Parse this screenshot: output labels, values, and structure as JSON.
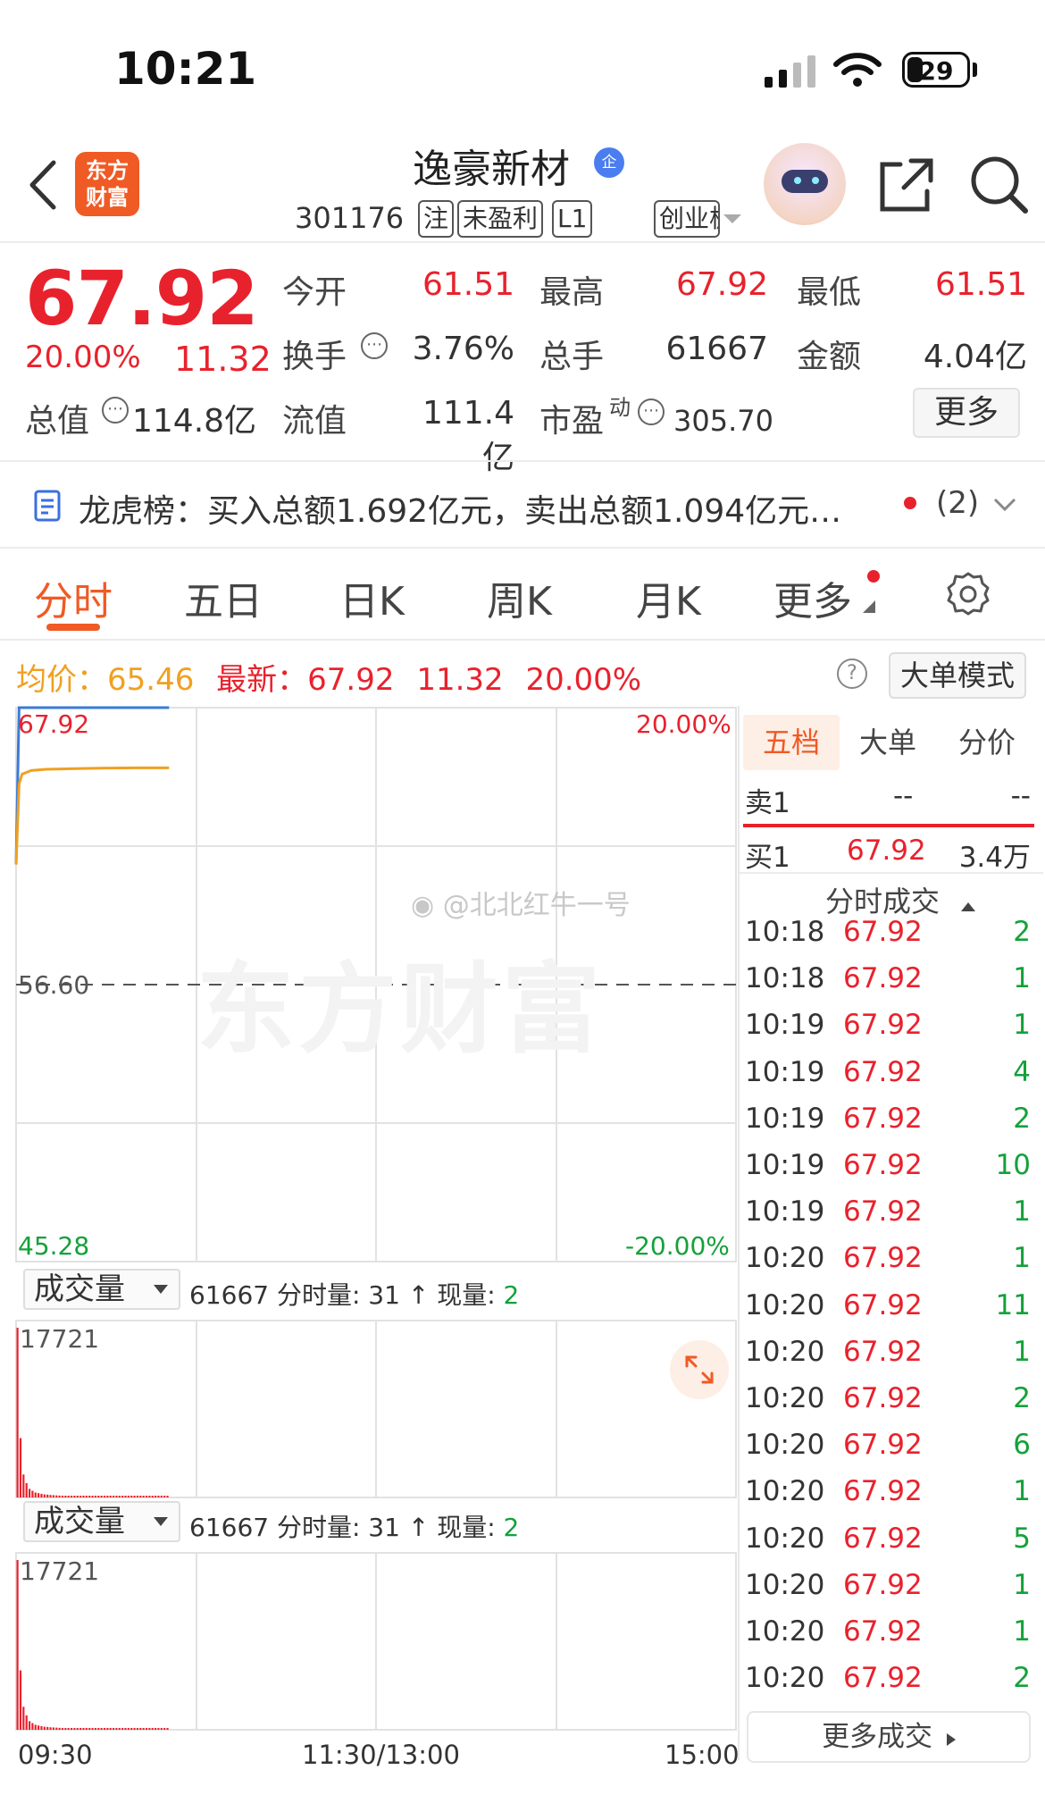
{
  "status_bar": {
    "time": "10:21",
    "battery": "29"
  },
  "header": {
    "logo_line1": "东方",
    "logo_line2": "财富",
    "title": "逸豪新材",
    "verified_badge": "企",
    "code": "301176",
    "tags": [
      "注",
      "未盈利",
      "L1"
    ],
    "board": "创业板"
  },
  "quote": {
    "price": "67.92",
    "change_pct": "20.00%",
    "change_amt": "11.32",
    "open_label": "今开",
    "open": "61.51",
    "high_label": "最高",
    "high": "67.92",
    "low_label": "最低",
    "low": "61.51",
    "turnover_label": "换手",
    "turnover": "3.76%",
    "volume_label": "总手",
    "volume": "61667",
    "amount_label": "金额",
    "amount": "4.04亿",
    "mktcap_label": "总值",
    "mktcap": "114.8亿",
    "float_label": "流值",
    "float_cap": "111.4亿",
    "pe_label": "市盈",
    "pe_sup": "动",
    "pe": "305.70",
    "more_button": "更多"
  },
  "dragon_tiger": {
    "text": "龙虎榜：买入总额1.692亿元，卖出总额1.094亿元…",
    "count": "(2)"
  },
  "tabs": [
    "分时",
    "五日",
    "日K",
    "周K",
    "月K",
    "更多"
  ],
  "info_row": {
    "avg_label": "均价：",
    "avg": "65.46",
    "latest_label": "最新：",
    "latest": "67.92",
    "latest_chg": "11.32",
    "latest_pct": "20.00%",
    "help_icon": "?",
    "bigorder_button": "大单模式"
  },
  "chart": {
    "y_top": "67.92",
    "y_mid": "56.60",
    "y_bottom": "45.28",
    "pct_top": "20.00%",
    "pct_bottom": "-20.00%",
    "watermark": "@北北红牛一号",
    "bg_watermark": "东方财富",
    "vol_selector": "成交量",
    "vol_info": "61667 分时量: 31 ↑ 现量: ",
    "vol_now": "2",
    "vol_max": "17721",
    "x_start": "09:30",
    "x_mid": "11:30/13:00",
    "x_end": "15:00"
  },
  "chart_data": {
    "type": "line",
    "title": "",
    "x": [
      "09:30",
      "09:31",
      "09:32",
      "09:35",
      "09:40",
      "09:50",
      "10:00",
      "10:10",
      "10:21"
    ],
    "series": [
      {
        "name": "",
        "values": [
          61.51,
          67.92,
          67.92,
          67.92,
          67.92,
          67.92,
          67.92,
          67.92,
          67.92
        ]
      },
      {
        "name": "均价",
        "values": [
          61.51,
          64.8,
          65.2,
          65.35,
          65.4,
          65.43,
          65.45,
          65.46,
          65.46
        ]
      }
    ],
    "ylim": [
      45.28,
      67.92
    ],
    "prev_close": 56.6,
    "volume_max": 17721
  },
  "order_book": {
    "tabs": [
      "五档",
      "大单",
      "分价"
    ],
    "sell1_label": "卖1",
    "sell1_price": "--",
    "sell1_vol": "--",
    "buy1_label": "买1",
    "buy1_price": "67.92",
    "buy1_vol": "3.4万"
  },
  "trades": {
    "header": "分时成交",
    "rows": [
      {
        "time": "10:18",
        "price": "67.92",
        "vol": "2"
      },
      {
        "time": "10:18",
        "price": "67.92",
        "vol": "1"
      },
      {
        "time": "10:19",
        "price": "67.92",
        "vol": "1"
      },
      {
        "time": "10:19",
        "price": "67.92",
        "vol": "4"
      },
      {
        "time": "10:19",
        "price": "67.92",
        "vol": "2"
      },
      {
        "time": "10:19",
        "price": "67.92",
        "vol": "10"
      },
      {
        "time": "10:19",
        "price": "67.92",
        "vol": "1"
      },
      {
        "time": "10:20",
        "price": "67.92",
        "vol": "1"
      },
      {
        "time": "10:20",
        "price": "67.92",
        "vol": "11"
      },
      {
        "time": "10:20",
        "price": "67.92",
        "vol": "1"
      },
      {
        "time": "10:20",
        "price": "67.92",
        "vol": "2"
      },
      {
        "time": "10:20",
        "price": "67.92",
        "vol": "6"
      },
      {
        "time": "10:20",
        "price": "67.92",
        "vol": "1"
      },
      {
        "time": "10:20",
        "price": "67.92",
        "vol": "5"
      },
      {
        "time": "10:20",
        "price": "67.92",
        "vol": "1"
      },
      {
        "time": "10:20",
        "price": "67.92",
        "vol": "1"
      },
      {
        "time": "10:20",
        "price": "67.92",
        "vol": "2"
      }
    ],
    "more_button": "更多成交"
  },
  "colors": {
    "up": "#e8222d",
    "down": "#14a13a",
    "accent": "#f05a24",
    "avg_line": "#f0a020",
    "price_line": "#3b7bd8"
  }
}
